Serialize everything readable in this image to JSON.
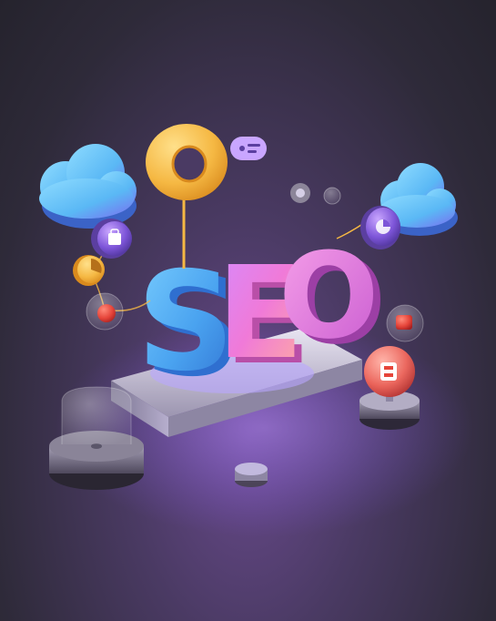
{
  "scene": {
    "headline_text": "SEO",
    "letters": [
      "S",
      "E",
      "O"
    ],
    "colors": {
      "background_dark": "#2e2a39",
      "glow_purple": "#8a5cff",
      "letter_s": "#4aa3f0",
      "letter_e": "#f07ad8",
      "letter_o": "#e46fd1",
      "ring_yellow": "#f5b843",
      "cloud_blue": "#5ab8f5",
      "icon_red": "#e6453a",
      "platform_silver": "#c9c4d6"
    },
    "icons": [
      "cloud-left-icon",
      "cloud-right-icon",
      "location-ring-icon",
      "chat-bubble-icon",
      "shopping-bag-node-icon",
      "pie-chart-node-icon",
      "rocket-node-icon",
      "bitcoin-orb-icon",
      "red-cube-icon"
    ]
  }
}
